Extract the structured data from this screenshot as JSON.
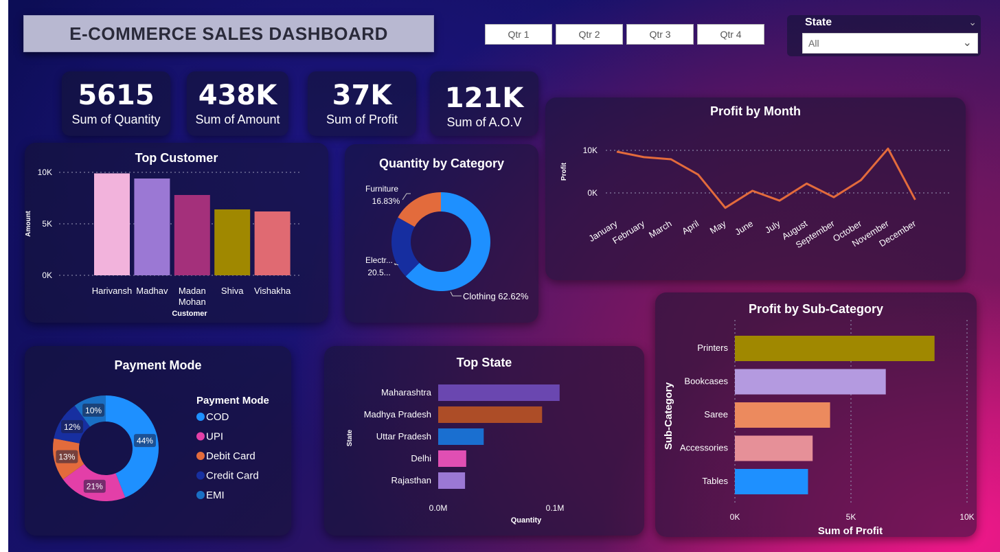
{
  "dashboard": {
    "title": "E-COMMERCE SALES DASHBOARD"
  },
  "quarter_filter": [
    "Qtr 1",
    "Qtr 2",
    "Qtr 3",
    "Qtr 4"
  ],
  "state_filter": {
    "label": "State",
    "selected": "All"
  },
  "kpis": [
    {
      "value": "5615",
      "label": "Sum of Quantity"
    },
    {
      "value": "438K",
      "label": "Sum of Amount"
    },
    {
      "value": "37K",
      "label": "Sum of Profit"
    },
    {
      "value": "121K",
      "label": "Sum of A.O.V"
    }
  ],
  "colors": {
    "accent_line": "#e36b3c"
  },
  "chart_data": [
    {
      "id": "top_customer",
      "type": "bar",
      "title": "Top Customer",
      "xlabel": "Customer",
      "ylabel": "Amount",
      "categories": [
        "Harivansh",
        "Madhav",
        "Madan Mohan",
        "Shiva",
        "Vishakha"
      ],
      "values": [
        9900,
        9400,
        7800,
        6400,
        6200
      ],
      "colors": [
        "#f2b3dc",
        "#9b78d4",
        "#a4307b",
        "#a08800",
        "#e06a72"
      ],
      "ylim": [
        0,
        10000
      ],
      "yticks": [
        "0K",
        "5K",
        "10K"
      ],
      "grid": true
    },
    {
      "id": "quantity_by_category",
      "type": "pie",
      "title": "Quantity by Category",
      "categories": [
        "Clothing",
        "Electronics",
        "Furniture"
      ],
      "values": [
        62.62,
        20.55,
        16.83
      ],
      "labels": [
        "Clothing 62.62%",
        "Electr...",
        "20.5...",
        "Furniture",
        "16.83%"
      ],
      "colors": [
        "#1e90ff",
        "#162ea0",
        "#e36b3c"
      ]
    },
    {
      "id": "profit_by_month",
      "type": "line",
      "title": "Profit by Month",
      "ylabel": "Profit",
      "categories": [
        "January",
        "February",
        "March",
        "April",
        "May",
        "June",
        "July",
        "August",
        "September",
        "October",
        "November",
        "December"
      ],
      "values": [
        9700,
        8400,
        7900,
        4300,
        -3500,
        500,
        -1800,
        2200,
        -1000,
        3000,
        10400,
        -1600
      ],
      "yticks": [
        "0K",
        "10K"
      ],
      "grid": true
    },
    {
      "id": "payment_mode",
      "type": "pie",
      "title": "Payment Mode",
      "legend_title": "Payment Mode",
      "legend_position": "right",
      "categories": [
        "COD",
        "UPI",
        "Debit Card",
        "Credit Card",
        "EMI"
      ],
      "values": [
        44,
        21,
        13,
        12,
        10
      ],
      "value_labels": [
        "44%",
        "21%",
        "13%",
        "12%",
        "10%"
      ],
      "colors": [
        "#1e90ff",
        "#e33fa8",
        "#e36b3c",
        "#172fa0",
        "#1a6fc4"
      ]
    },
    {
      "id": "top_state",
      "type": "bar",
      "orientation": "horizontal",
      "title": "Top State",
      "xlabel": "Quantity",
      "ylabel": "State",
      "categories": [
        "Maharashtra",
        "Madhya Pradesh",
        "Uttar Pradesh",
        "Delhi",
        "Rajasthan"
      ],
      "values": [
        104000,
        89000,
        39000,
        24000,
        23000
      ],
      "colors": [
        "#6a47b0",
        "#ad4d27",
        "#1a6fd0",
        "#e04fb3",
        "#9b78d4"
      ],
      "xlim": [
        0,
        100000
      ],
      "xticks": [
        "0.0M",
        "0.1M"
      ]
    },
    {
      "id": "profit_by_subcategory",
      "type": "bar",
      "orientation": "horizontal",
      "title": "Profit by Sub-Category",
      "xlabel": "Sum of Profit",
      "ylabel": "Sub-Category",
      "categories": [
        "Printers",
        "Bookcases",
        "Saree",
        "Accessories",
        "Tables"
      ],
      "values": [
        8600,
        6500,
        4100,
        3350,
        3150
      ],
      "colors": [
        "#a08800",
        "#b49ae0",
        "#ec8a5e",
        "#e69098",
        "#1e90ff"
      ],
      "xlim": [
        0,
        10000
      ],
      "xticks": [
        "0K",
        "5K",
        "10K"
      ],
      "grid": true
    }
  ]
}
